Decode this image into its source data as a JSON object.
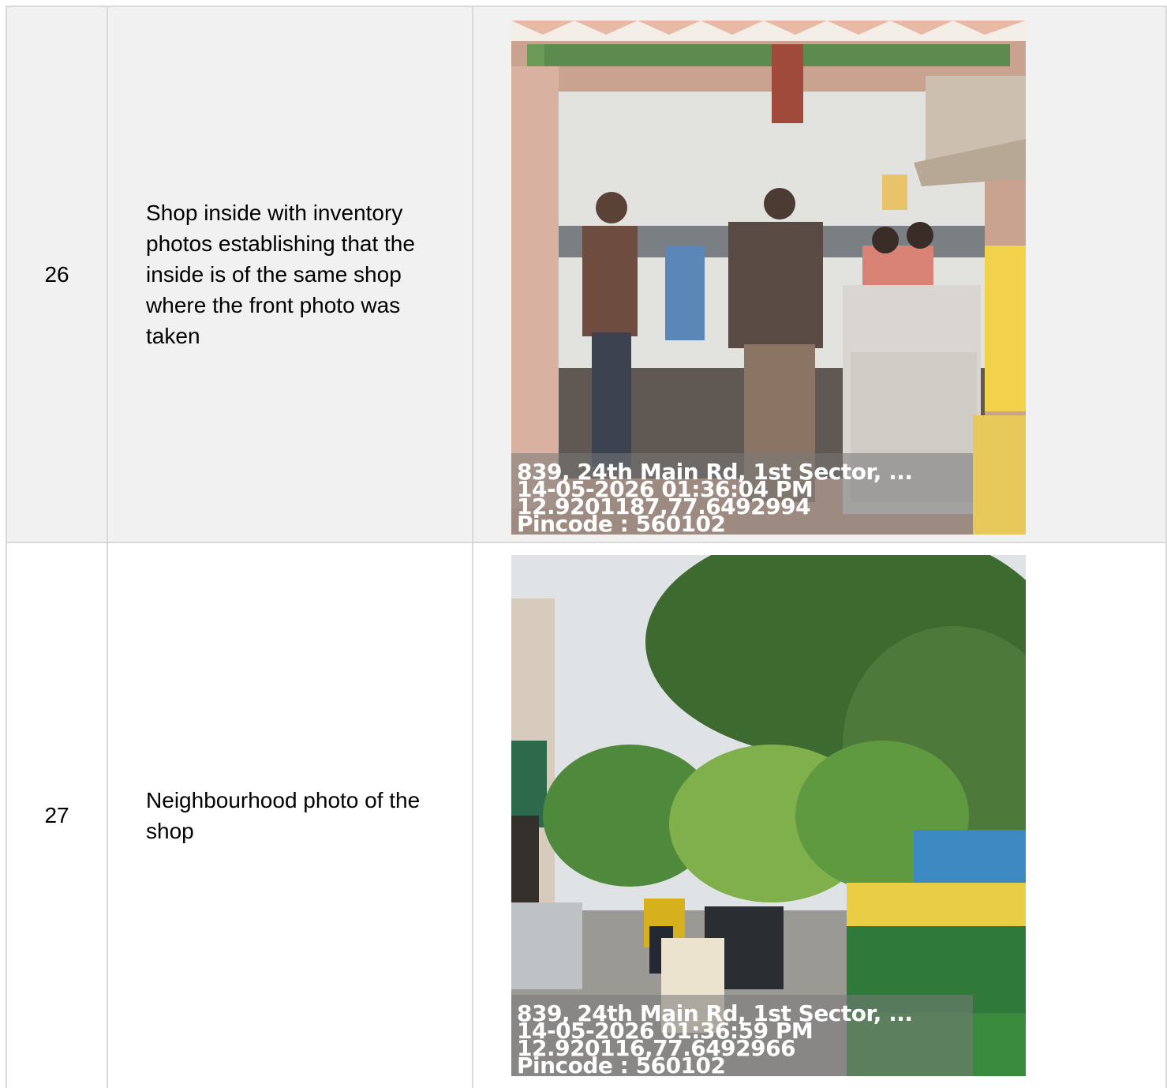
{
  "rows": [
    {
      "number": "26",
      "description": "Shop inside with inventory photos establishing that the inside is of the same shop where the front photo was taken",
      "photo": {
        "scene": "shop-interior",
        "address": "839, 24th Main Rd, 1st Sector, ...",
        "datetime": "14-05-2026 01:36:04 PM",
        "coordinates": "12.9201187,77.6492994",
        "pincode": "Pincode : 560102"
      }
    },
    {
      "number": "27",
      "description": "Neighbourhood photo of the shop",
      "photo": {
        "scene": "street-neighbourhood",
        "address": "839, 24th Main Rd, 1st Sector, ...",
        "datetime": "14-05-2026 01:36:59 PM",
        "coordinates": "12.920116,77.6492966",
        "pincode": "Pincode : 560102"
      }
    }
  ],
  "colors": {
    "row_alt_bg": "#f1f1f1",
    "grid": "#d9d9d9",
    "stamp_text": "#ffffff"
  }
}
